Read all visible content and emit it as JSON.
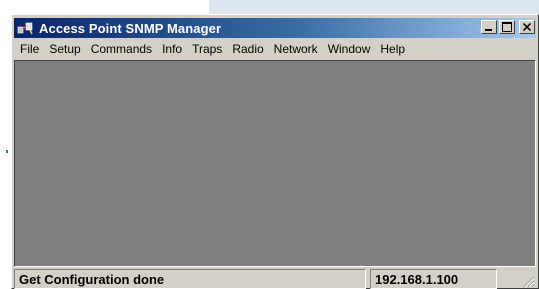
{
  "window": {
    "title": "Access Point SNMP Manager"
  },
  "menu": {
    "items": [
      "File",
      "Setup",
      "Commands",
      "Info",
      "Traps",
      "Radio",
      "Network",
      "Window",
      "Help"
    ]
  },
  "status": {
    "message": "Get Configuration done",
    "ip": "192.168.1.100"
  },
  "icons": {
    "app": "snmp-app-icon",
    "minimize": "minimize-icon",
    "maximize": "maximize-icon",
    "close": "close-icon",
    "grip": "resize-grip-icon"
  },
  "colors": {
    "titlebar_start": "#0a246a",
    "titlebar_end": "#a6caf0",
    "workspace": "#808080",
    "chrome": "#d4d0c8"
  }
}
